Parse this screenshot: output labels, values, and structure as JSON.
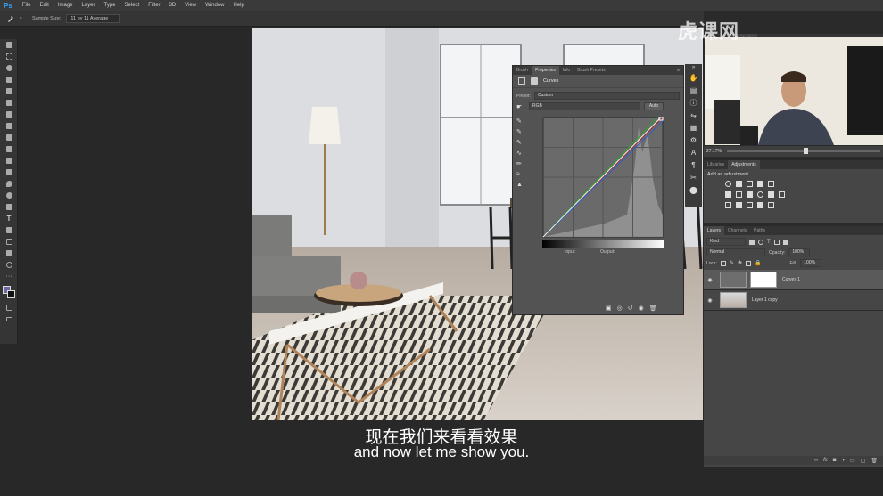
{
  "app": {
    "logo": "Ps"
  },
  "menu": [
    "File",
    "Edit",
    "Image",
    "Layer",
    "Type",
    "Select",
    "Filter",
    "3D",
    "View",
    "Window",
    "Help"
  ],
  "options_bar": {
    "sample_size_label": "Sample Size:",
    "sample_size_value": "11 by 11 Average"
  },
  "properties_panel": {
    "tabs": [
      "Brush",
      "Properties",
      "Info",
      "Brush Presets"
    ],
    "active_tab": "Properties",
    "title": "Curves",
    "preset_label": "Preset:",
    "preset_value": "Custom",
    "channel_value": "RGB",
    "auto_label": "Auto",
    "input_label": "Input:",
    "output_label": "Output:"
  },
  "navigator": {
    "tabs": [
      "Histogram",
      "Navigator"
    ],
    "active_tab": "Navigator",
    "zoom": "27.17%"
  },
  "adjustments": {
    "tabs": [
      "Libraries",
      "Adjustments"
    ],
    "active_tab": "Adjustments",
    "subtitle": "Add an adjustment"
  },
  "layers": {
    "tabs": [
      "Layers",
      "Channels",
      "Paths"
    ],
    "active_tab": "Layers",
    "filter_kind": "Kind",
    "blend_mode": "Normal",
    "opacity_label": "Opacity:",
    "opacity_value": "100%",
    "lock_label": "Lock:",
    "fill_label": "Fill:",
    "fill_value": "100%",
    "items": [
      {
        "name": "Curves 1"
      },
      {
        "name": "Layer 1 copy"
      }
    ]
  },
  "watermark": "虎课网",
  "subtitle": {
    "chinese": "现在我们来看看效果",
    "english": "and now let me show you."
  },
  "colors": {
    "ps_blue": "#31a8ff",
    "app_bg": "#282828",
    "panel_bg": "#535353",
    "menubar_bg": "#3a3a3a"
  }
}
